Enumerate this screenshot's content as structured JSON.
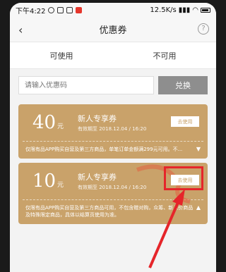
{
  "status_bar": {
    "time": "下午4:22",
    "network": "12.5K/s",
    "battery_level": 0.7
  },
  "header": {
    "title": "优惠券"
  },
  "tabs": [
    {
      "label": "可使用"
    },
    {
      "label": "不可用"
    }
  ],
  "redeem": {
    "placeholder": "请输入优惠码",
    "button_label": "兑换"
  },
  "coupons": [
    {
      "amount": "40",
      "unit": "元",
      "title": "新人专享券",
      "validity": "有效期至 2018.12.04 / 16:20",
      "use_label": "去使用",
      "description": "仅限有品APP购买自营及第三方商品，单笔订单金额满299元可用。不...",
      "expanded": false
    },
    {
      "amount": "10",
      "unit": "元",
      "title": "新人专享券",
      "validity": "有效期至 2018.12.04 / 16:20",
      "use_label": "去使用",
      "description": "仅限有品APP购买自营及第三方商品可用，不包含赠对购，众筹、新入价商品及特殊限定商品，具体以结算页使用为准。",
      "expanded": true
    }
  ],
  "colors": {
    "coupon_gold": "#c9a26a",
    "annotation_red": "#e5252a"
  }
}
